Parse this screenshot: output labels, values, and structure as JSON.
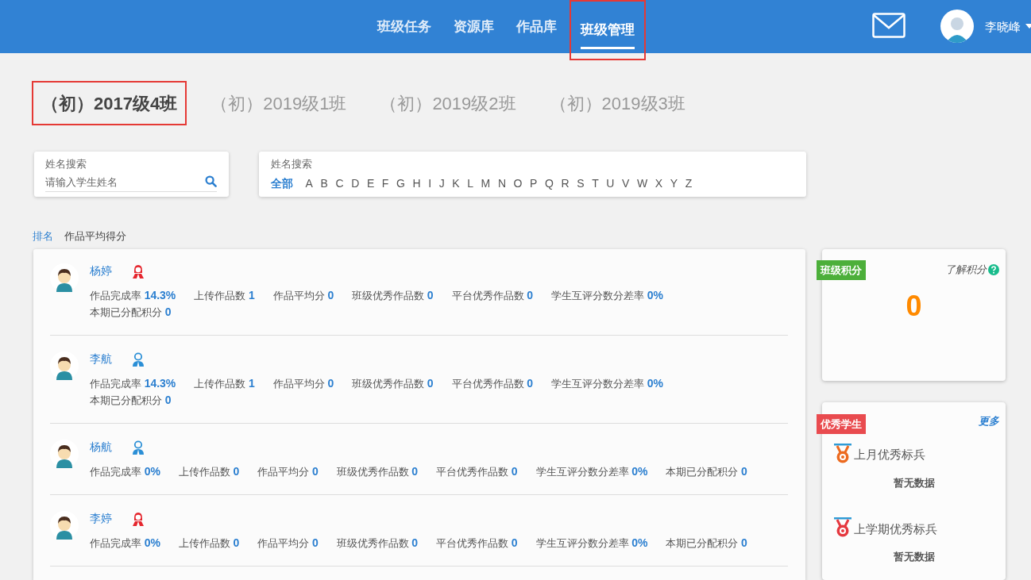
{
  "nav": [
    {
      "label": "班级任务",
      "selected": false,
      "highlighted": false
    },
    {
      "label": "资源库",
      "selected": false,
      "highlighted": false
    },
    {
      "label": "作品库",
      "selected": false,
      "highlighted": false
    },
    {
      "label": "班级管理",
      "selected": true,
      "highlighted": true
    }
  ],
  "user": {
    "name": "李晓峰"
  },
  "class_tabs": [
    {
      "label": "（初）2017级4班",
      "selected": true,
      "highlighted": true
    },
    {
      "label": "（初）2019级1班",
      "selected": false,
      "highlighted": false
    },
    {
      "label": "（初）2019级2班",
      "selected": false,
      "highlighted": false
    },
    {
      "label": "（初）2019级3班",
      "selected": false,
      "highlighted": false
    }
  ],
  "name_search": {
    "label": "姓名搜索",
    "placeholder": "请输入学生姓名"
  },
  "letter_filter": {
    "label": "姓名搜索",
    "letters": [
      {
        "label": "全部",
        "selected": true
      },
      {
        "label": "A",
        "selected": false
      },
      {
        "label": "B",
        "selected": false
      },
      {
        "label": "C",
        "selected": false
      },
      {
        "label": "D",
        "selected": false
      },
      {
        "label": "E",
        "selected": false
      },
      {
        "label": "F",
        "selected": false
      },
      {
        "label": "G",
        "selected": false
      },
      {
        "label": "H",
        "selected": false
      },
      {
        "label": "I",
        "selected": false
      },
      {
        "label": "J",
        "selected": false
      },
      {
        "label": "K",
        "selected": false
      },
      {
        "label": "L",
        "selected": false
      },
      {
        "label": "M",
        "selected": false
      },
      {
        "label": "N",
        "selected": false
      },
      {
        "label": "O",
        "selected": false
      },
      {
        "label": "P",
        "selected": false
      },
      {
        "label": "Q",
        "selected": false
      },
      {
        "label": "R",
        "selected": false
      },
      {
        "label": "S",
        "selected": false
      },
      {
        "label": "T",
        "selected": false
      },
      {
        "label": "U",
        "selected": false
      },
      {
        "label": "V",
        "selected": false
      },
      {
        "label": "W",
        "selected": false
      },
      {
        "label": "X",
        "selected": false
      },
      {
        "label": "Y",
        "selected": false
      },
      {
        "label": "Z",
        "selected": false
      }
    ]
  },
  "sort_options": [
    {
      "label": "排名",
      "selected": true
    },
    {
      "label": "作品平均得分",
      "selected": false
    }
  ],
  "students": [
    {
      "name": "杨婷",
      "kind": "female",
      "stats": [
        {
          "label": "作品完成率",
          "value": "14.3%"
        },
        {
          "label": "上传作品数",
          "value": "1"
        },
        {
          "label": "作品平均分",
          "value": "0"
        },
        {
          "label": "班级优秀作品数",
          "value": "0"
        },
        {
          "label": "平台优秀作品数",
          "value": "0"
        },
        {
          "label": "学生互评分数分差率",
          "value": "0%"
        },
        {
          "label": "本期已分配积分",
          "value": "0"
        }
      ]
    },
    {
      "name": "李航",
      "kind": "male",
      "stats": [
        {
          "label": "作品完成率",
          "value": "14.3%"
        },
        {
          "label": "上传作品数",
          "value": "1"
        },
        {
          "label": "作品平均分",
          "value": "0"
        },
        {
          "label": "班级优秀作品数",
          "value": "0"
        },
        {
          "label": "平台优秀作品数",
          "value": "0"
        },
        {
          "label": "学生互评分数分差率",
          "value": "0%"
        },
        {
          "label": "本期已分配积分",
          "value": "0"
        }
      ]
    },
    {
      "name": "杨航",
      "kind": "male",
      "stats": [
        {
          "label": "作品完成率",
          "value": "0%"
        },
        {
          "label": "上传作品数",
          "value": "0"
        },
        {
          "label": "作品平均分",
          "value": "0"
        },
        {
          "label": "班级优秀作品数",
          "value": "0"
        },
        {
          "label": "平台优秀作品数",
          "value": "0"
        },
        {
          "label": "学生互评分数分差率",
          "value": "0%"
        },
        {
          "label": "本期已分配积分",
          "value": "0"
        }
      ]
    },
    {
      "name": "李婷",
      "kind": "female",
      "stats": [
        {
          "label": "作品完成率",
          "value": "0%"
        },
        {
          "label": "上传作品数",
          "value": "0"
        },
        {
          "label": "作品平均分",
          "value": "0"
        },
        {
          "label": "班级优秀作品数",
          "value": "0"
        },
        {
          "label": "平台优秀作品数",
          "value": "0"
        },
        {
          "label": "学生互评分数分差率",
          "value": "0%"
        },
        {
          "label": "本期已分配积分",
          "value": "0"
        }
      ]
    }
  ],
  "class_points": {
    "tag": "班级积分",
    "link": "了解积分",
    "value": "0"
  },
  "top_students": {
    "tag": "优秀学生",
    "link": "更多",
    "sections": [
      {
        "title": "上月优秀标兵",
        "color": "#ec6a1f",
        "empty_text": "暂无数据"
      },
      {
        "title": "上学期优秀标兵",
        "color": "#e5383f",
        "empty_text": "暂无数据"
      }
    ]
  }
}
